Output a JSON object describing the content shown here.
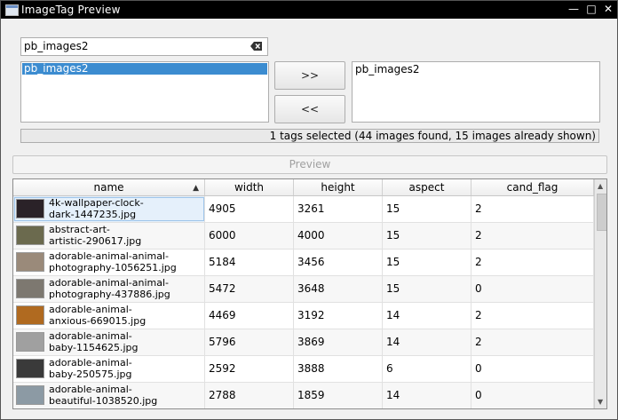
{
  "window": {
    "title": "ImageTag Preview",
    "min_label": "—",
    "max_label": "□",
    "close_label": "✕"
  },
  "search": {
    "value": "pb_images2",
    "clear_icon": "backspace-clear-icon"
  },
  "available": {
    "items": [
      "pb_images2"
    ]
  },
  "buttons": {
    "add": ">>",
    "remove": "<<",
    "preview": "Preview"
  },
  "selected": {
    "items": [
      "pb_images2"
    ]
  },
  "status": "1 tags selected (44 images found, 15 images already shown)",
  "table": {
    "columns": [
      "name",
      "width",
      "height",
      "aspect",
      "cand_flag"
    ],
    "sort_column": "name",
    "rows": [
      {
        "name": "4k-wallpaper-clock-\ndark-1447235.jpg",
        "width": "4905",
        "height": "3261",
        "aspect": "15",
        "cand_flag": "2",
        "thumb": "#2a2228"
      },
      {
        "name": "abstract-art-\nartistic-290617.jpg",
        "width": "6000",
        "height": "4000",
        "aspect": "15",
        "cand_flag": "2",
        "thumb": "#6b6a4e"
      },
      {
        "name": "adorable-animal-animal-\nphotography-1056251.jpg",
        "width": "5184",
        "height": "3456",
        "aspect": "15",
        "cand_flag": "2",
        "thumb": "#9a8a7a"
      },
      {
        "name": "adorable-animal-animal-\nphotography-437886.jpg",
        "width": "5472",
        "height": "3648",
        "aspect": "15",
        "cand_flag": "0",
        "thumb": "#7d7870"
      },
      {
        "name": "adorable-animal-\nanxious-669015.jpg",
        "width": "4469",
        "height": "3192",
        "aspect": "14",
        "cand_flag": "2",
        "thumb": "#b06a20"
      },
      {
        "name": "adorable-animal-\nbaby-1154625.jpg",
        "width": "5796",
        "height": "3869",
        "aspect": "14",
        "cand_flag": "2",
        "thumb": "#a0a0a0"
      },
      {
        "name": "adorable-animal-\nbaby-250575.jpg",
        "width": "2592",
        "height": "3888",
        "aspect": "6",
        "cand_flag": "0",
        "thumb": "#3a3a3a"
      },
      {
        "name": "adorable-animal-\nbeautiful-1038520.jpg",
        "width": "2788",
        "height": "1859",
        "aspect": "14",
        "cand_flag": "0",
        "thumb": "#8c9aa4"
      }
    ]
  }
}
